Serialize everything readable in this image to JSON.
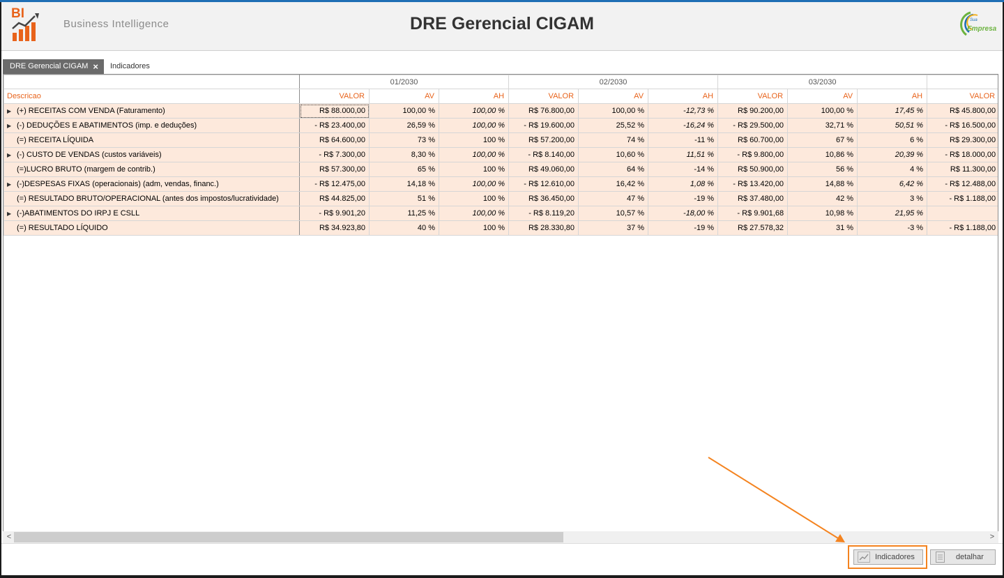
{
  "header": {
    "logo_text": "BI",
    "subtitle": "Business Intelligence",
    "title": "DRE Gerencial CIGAM",
    "brand_sua": "Sua",
    "brand_empresa": "Empresa"
  },
  "tabs": [
    {
      "label": "DRE Gerencial CIGAM",
      "close": "×"
    },
    {
      "label": "Indicadores"
    }
  ],
  "grid": {
    "periods": [
      "01/2030",
      "02/2030",
      "03/2030"
    ],
    "col_desc": "Descricao",
    "col_valor": "VALOR",
    "col_av": "AV",
    "col_ah": "AH",
    "rows": [
      {
        "desc": "(+) RECEITAS COM VENDA (Faturamento)",
        "expandable": true,
        "p1": [
          "R$ 88.000,00",
          "100,00 %",
          "100,00 %"
        ],
        "p1_ah": "pos",
        "p2": [
          "R$ 76.800,00",
          "100,00 %",
          "-12,73 %"
        ],
        "p2_ah": "neg",
        "p3": [
          "R$ 90.200,00",
          "100,00 %",
          "17,45 %"
        ],
        "p3_ah": "pos",
        "p4": "R$ 45.800,00"
      },
      {
        "desc": "(-) DEDUÇÕES E ABATIMENTOS (imp. e deduções)",
        "expandable": true,
        "p1": [
          "- R$ 23.400,00",
          "26,59 %",
          "100,00 %"
        ],
        "p1_ah": "pos",
        "p2": [
          "- R$ 19.600,00",
          "25,52 %",
          "-16,24 %"
        ],
        "p2_ah": "neg",
        "p3": [
          "- R$ 29.500,00",
          "32,71 %",
          "50,51 %"
        ],
        "p3_ah": "pos",
        "p4": "- R$ 16.500,00"
      },
      {
        "desc": "(=) RECEITA LÍQUIDA",
        "expandable": false,
        "p1": [
          "R$ 64.600,00",
          "73 %",
          "100 %"
        ],
        "p1_ah": "plain",
        "p2": [
          "R$ 57.200,00",
          "74 %",
          "-11 %"
        ],
        "p2_ah": "plain",
        "p3": [
          "R$ 60.700,00",
          "67 %",
          "6 %"
        ],
        "p3_ah": "plain",
        "p4": "R$ 29.300,00"
      },
      {
        "desc": "(-) CUSTO DE VENDAS (custos variáveis)",
        "expandable": true,
        "p1": [
          "- R$ 7.300,00",
          "8,30 %",
          "100,00 %"
        ],
        "p1_ah": "pos",
        "p2": [
          "- R$ 8.140,00",
          "10,60 %",
          "11,51 %"
        ],
        "p2_ah": "pos",
        "p3": [
          "- R$ 9.800,00",
          "10,86 %",
          "20,39 %"
        ],
        "p3_ah": "pos",
        "p4": "- R$ 18.000,00"
      },
      {
        "desc": "(=)LUCRO BRUTO (margem de contrib.)",
        "expandable": false,
        "p1": [
          "R$ 57.300,00",
          "65 %",
          "100 %"
        ],
        "p1_ah": "plain",
        "p2": [
          "R$ 49.060,00",
          "64 %",
          "-14 %"
        ],
        "p2_ah": "plain",
        "p3": [
          "R$ 50.900,00",
          "56 %",
          "4 %"
        ],
        "p3_ah": "plain",
        "p4": "R$ 11.300,00"
      },
      {
        "desc": "(-)DESPESAS FIXAS (operacionais) (adm, vendas, financ.)",
        "expandable": true,
        "p1": [
          "- R$ 12.475,00",
          "14,18 %",
          "100,00 %"
        ],
        "p1_ah": "pos",
        "p2": [
          "- R$ 12.610,00",
          "16,42 %",
          "1,08 %"
        ],
        "p2_ah": "pos",
        "p3": [
          "- R$ 13.420,00",
          "14,88 %",
          "6,42 %"
        ],
        "p3_ah": "pos",
        "p4": "- R$ 12.488,00"
      },
      {
        "desc": "(=) RESULTADO BRUTO/OPERACIONAL (antes dos impostos/lucratividade)",
        "expandable": false,
        "p1": [
          "R$ 44.825,00",
          "51 %",
          "100 %"
        ],
        "p1_ah": "plain",
        "p2": [
          "R$ 36.450,00",
          "47 %",
          "-19 %"
        ],
        "p2_ah": "plain",
        "p3": [
          "R$ 37.480,00",
          "42 %",
          "3 %"
        ],
        "p3_ah": "plain",
        "p4": "- R$ 1.188,00"
      },
      {
        "desc": "(-)ABATIMENTOS DO IRPJ E CSLL",
        "expandable": true,
        "p1": [
          "- R$ 9.901,20",
          "11,25 %",
          "100,00 %"
        ],
        "p1_ah": "pos",
        "p2": [
          "- R$ 8.119,20",
          "10,57 %",
          "-18,00 %"
        ],
        "p2_ah": "neg",
        "p3": [
          "- R$ 9.901,68",
          "10,98 %",
          "21,95 %"
        ],
        "p3_ah": "pos",
        "p4": ""
      },
      {
        "desc": "(=) RESULTADO LÍQUIDO",
        "expandable": false,
        "p1": [
          "R$ 34.923,80",
          "40 %",
          "100 %"
        ],
        "p1_ah": "plain",
        "p2": [
          "R$ 28.330,80",
          "37 %",
          "-19 %"
        ],
        "p2_ah": "plain",
        "p3": [
          "R$ 27.578,32",
          "31 %",
          "-3 %"
        ],
        "p3_ah": "plain",
        "p4": "- R$ 1.188,00"
      }
    ]
  },
  "scrollbar": {
    "left_arrow": "<",
    "right_arrow": ">"
  },
  "footer": {
    "indicadores_label": "Indicadores",
    "detalhar_label": "detalhar"
  },
  "colors": {
    "accent": "#e8631b",
    "row_bg": "#fde9dc",
    "negative": "#c81010",
    "positive": "#1a6db5",
    "highlight": "#f4831f"
  }
}
